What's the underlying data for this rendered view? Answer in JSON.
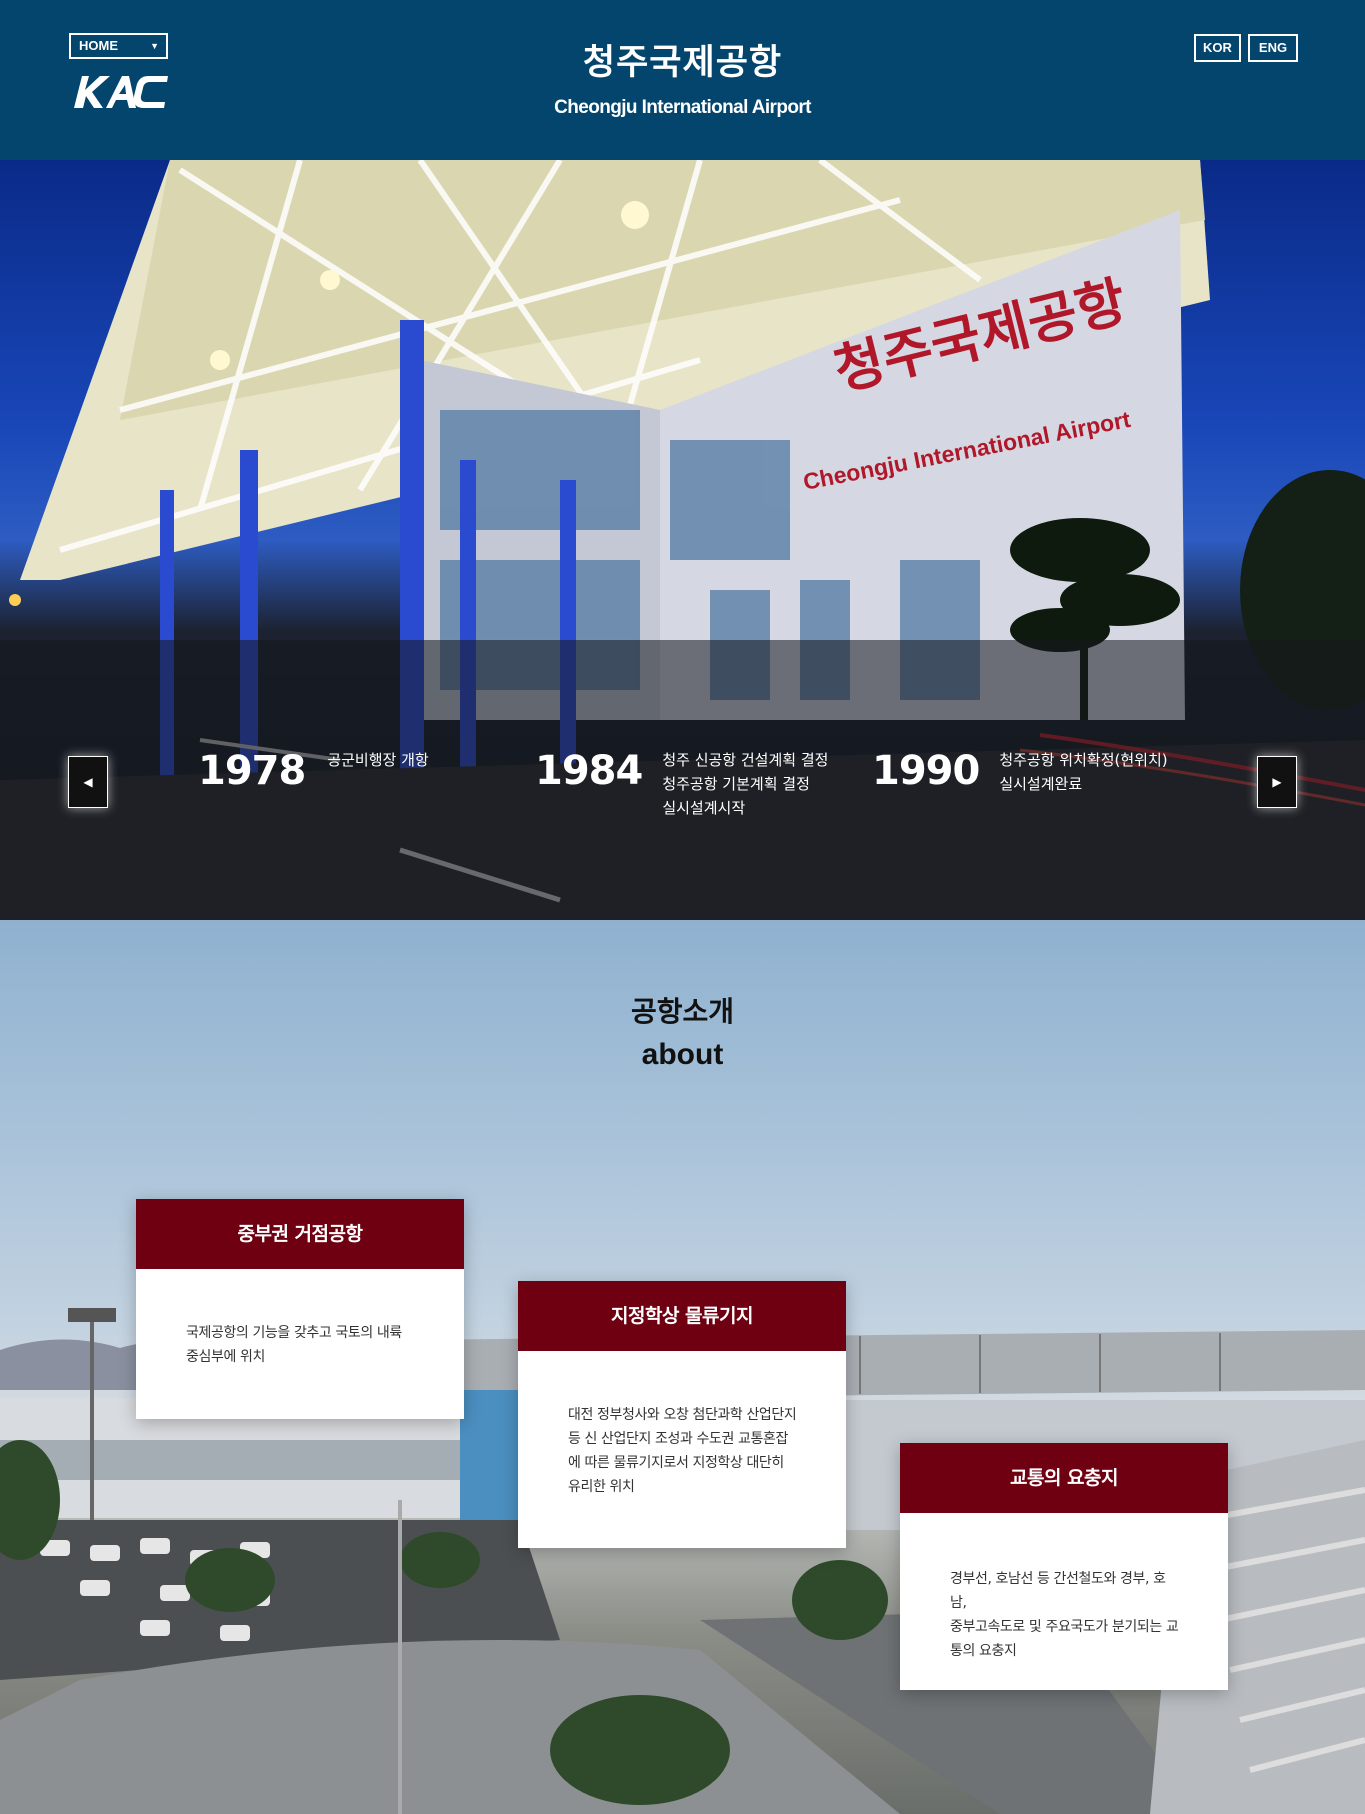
{
  "header": {
    "home_select": "HOME",
    "title": "청주국제공항",
    "subtitle": "Cheongju International Airport",
    "logo": "KAC",
    "lang_kor": "KOR",
    "lang_eng": "ENG"
  },
  "hero": {
    "sign_ko": "청주국제공항",
    "sign_en": "Cheongju International Airport",
    "prev_icon": "chevron-left-icon",
    "next_icon": "chevron-right-icon",
    "timeline": [
      {
        "year": "1978",
        "lines": [
          "공군비행장 개항"
        ]
      },
      {
        "year": "1984",
        "lines": [
          "청주 신공항 건설계획 결정",
          "청주공항 기본계획 결정",
          "실시설계시작"
        ]
      },
      {
        "year": "1990",
        "lines": [
          "청주공항 위치확정(현위치)",
          "실시설계완료"
        ]
      }
    ]
  },
  "about": {
    "title_ko": "공항소개",
    "title_en": "about",
    "cards": [
      {
        "title": "중부권 거점공항",
        "lines": [
          "국제공항의 기능을 갖추고 국토의 내륙",
          "중심부에 위치"
        ]
      },
      {
        "title": "지정학상 물류기지",
        "lines": [
          "대전 정부청사와 오창 첨단과학 산업단지",
          "등 신 산업단지 조성과 수도권 교통혼잡",
          "에 따른 물류기지로서 지정학상 대단히",
          "유리한 위치"
        ]
      },
      {
        "title": "교통의 요충지",
        "lines": [
          "경부선, 호남선 등 간선철도와 경부, 호남,",
          "중부고속도로 및 주요국도가 분기되는 교",
          "통의 요충지"
        ]
      }
    ]
  },
  "colors": {
    "header_bg": "#03456c",
    "card_head": "#6e0011",
    "sign_red": "#b0182a"
  }
}
